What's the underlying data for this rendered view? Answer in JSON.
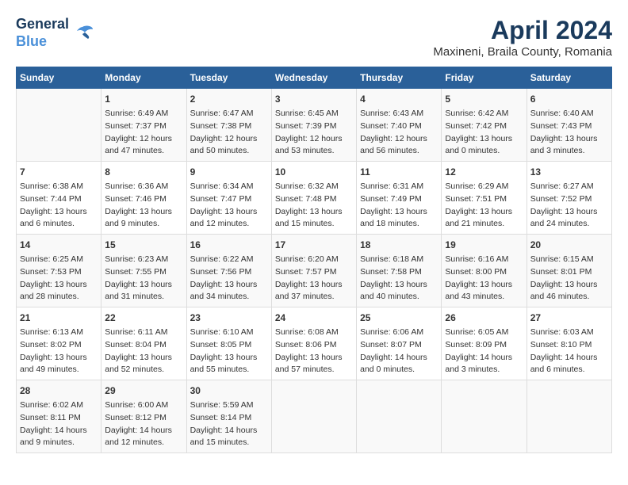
{
  "header": {
    "logo_line1": "General",
    "logo_line2": "Blue",
    "title": "April 2024",
    "subtitle": "Maxineni, Braila County, Romania"
  },
  "days_of_week": [
    "Sunday",
    "Monday",
    "Tuesday",
    "Wednesday",
    "Thursday",
    "Friday",
    "Saturday"
  ],
  "weeks": [
    [
      {
        "day": "",
        "content": ""
      },
      {
        "day": "1",
        "content": "Sunrise: 6:49 AM\nSunset: 7:37 PM\nDaylight: 12 hours\nand 47 minutes."
      },
      {
        "day": "2",
        "content": "Sunrise: 6:47 AM\nSunset: 7:38 PM\nDaylight: 12 hours\nand 50 minutes."
      },
      {
        "day": "3",
        "content": "Sunrise: 6:45 AM\nSunset: 7:39 PM\nDaylight: 12 hours\nand 53 minutes."
      },
      {
        "day": "4",
        "content": "Sunrise: 6:43 AM\nSunset: 7:40 PM\nDaylight: 12 hours\nand 56 minutes."
      },
      {
        "day": "5",
        "content": "Sunrise: 6:42 AM\nSunset: 7:42 PM\nDaylight: 13 hours\nand 0 minutes."
      },
      {
        "day": "6",
        "content": "Sunrise: 6:40 AM\nSunset: 7:43 PM\nDaylight: 13 hours\nand 3 minutes."
      }
    ],
    [
      {
        "day": "7",
        "content": "Sunrise: 6:38 AM\nSunset: 7:44 PM\nDaylight: 13 hours\nand 6 minutes."
      },
      {
        "day": "8",
        "content": "Sunrise: 6:36 AM\nSunset: 7:46 PM\nDaylight: 13 hours\nand 9 minutes."
      },
      {
        "day": "9",
        "content": "Sunrise: 6:34 AM\nSunset: 7:47 PM\nDaylight: 13 hours\nand 12 minutes."
      },
      {
        "day": "10",
        "content": "Sunrise: 6:32 AM\nSunset: 7:48 PM\nDaylight: 13 hours\nand 15 minutes."
      },
      {
        "day": "11",
        "content": "Sunrise: 6:31 AM\nSunset: 7:49 PM\nDaylight: 13 hours\nand 18 minutes."
      },
      {
        "day": "12",
        "content": "Sunrise: 6:29 AM\nSunset: 7:51 PM\nDaylight: 13 hours\nand 21 minutes."
      },
      {
        "day": "13",
        "content": "Sunrise: 6:27 AM\nSunset: 7:52 PM\nDaylight: 13 hours\nand 24 minutes."
      }
    ],
    [
      {
        "day": "14",
        "content": "Sunrise: 6:25 AM\nSunset: 7:53 PM\nDaylight: 13 hours\nand 28 minutes."
      },
      {
        "day": "15",
        "content": "Sunrise: 6:23 AM\nSunset: 7:55 PM\nDaylight: 13 hours\nand 31 minutes."
      },
      {
        "day": "16",
        "content": "Sunrise: 6:22 AM\nSunset: 7:56 PM\nDaylight: 13 hours\nand 34 minutes."
      },
      {
        "day": "17",
        "content": "Sunrise: 6:20 AM\nSunset: 7:57 PM\nDaylight: 13 hours\nand 37 minutes."
      },
      {
        "day": "18",
        "content": "Sunrise: 6:18 AM\nSunset: 7:58 PM\nDaylight: 13 hours\nand 40 minutes."
      },
      {
        "day": "19",
        "content": "Sunrise: 6:16 AM\nSunset: 8:00 PM\nDaylight: 13 hours\nand 43 minutes."
      },
      {
        "day": "20",
        "content": "Sunrise: 6:15 AM\nSunset: 8:01 PM\nDaylight: 13 hours\nand 46 minutes."
      }
    ],
    [
      {
        "day": "21",
        "content": "Sunrise: 6:13 AM\nSunset: 8:02 PM\nDaylight: 13 hours\nand 49 minutes."
      },
      {
        "day": "22",
        "content": "Sunrise: 6:11 AM\nSunset: 8:04 PM\nDaylight: 13 hours\nand 52 minutes."
      },
      {
        "day": "23",
        "content": "Sunrise: 6:10 AM\nSunset: 8:05 PM\nDaylight: 13 hours\nand 55 minutes."
      },
      {
        "day": "24",
        "content": "Sunrise: 6:08 AM\nSunset: 8:06 PM\nDaylight: 13 hours\nand 57 minutes."
      },
      {
        "day": "25",
        "content": "Sunrise: 6:06 AM\nSunset: 8:07 PM\nDaylight: 14 hours\nand 0 minutes."
      },
      {
        "day": "26",
        "content": "Sunrise: 6:05 AM\nSunset: 8:09 PM\nDaylight: 14 hours\nand 3 minutes."
      },
      {
        "day": "27",
        "content": "Sunrise: 6:03 AM\nSunset: 8:10 PM\nDaylight: 14 hours\nand 6 minutes."
      }
    ],
    [
      {
        "day": "28",
        "content": "Sunrise: 6:02 AM\nSunset: 8:11 PM\nDaylight: 14 hours\nand 9 minutes."
      },
      {
        "day": "29",
        "content": "Sunrise: 6:00 AM\nSunset: 8:12 PM\nDaylight: 14 hours\nand 12 minutes."
      },
      {
        "day": "30",
        "content": "Sunrise: 5:59 AM\nSunset: 8:14 PM\nDaylight: 14 hours\nand 15 minutes."
      },
      {
        "day": "",
        "content": ""
      },
      {
        "day": "",
        "content": ""
      },
      {
        "day": "",
        "content": ""
      },
      {
        "day": "",
        "content": ""
      }
    ]
  ]
}
